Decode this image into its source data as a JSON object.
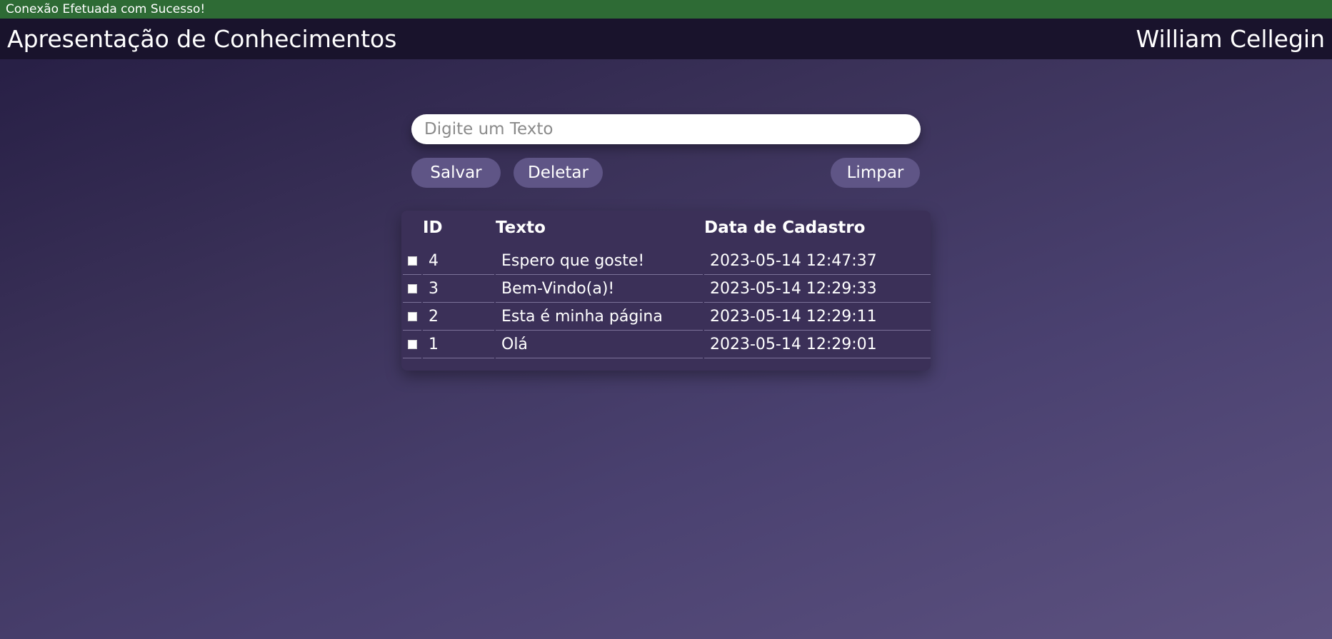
{
  "status": {
    "message": "Conexão Efetuada com Sucesso!",
    "color": "#2e6b35"
  },
  "header": {
    "title": "Apresentação de Conhecimentos",
    "author": "William Cellegin"
  },
  "form": {
    "input_value": "",
    "input_placeholder": "Digite um Texto",
    "save_label": "Salvar",
    "delete_label": "Deletar",
    "clear_label": "Limpar"
  },
  "table": {
    "columns": [
      "ID",
      "Texto",
      "Data de Cadastro"
    ],
    "rows": [
      {
        "checked": false,
        "id": "4",
        "text": "Espero que goste!",
        "date": "2023-05-14 12:47:37"
      },
      {
        "checked": false,
        "id": "3",
        "text": "Bem-Vindo(a)!",
        "date": "2023-05-14 12:29:33"
      },
      {
        "checked": false,
        "id": "2",
        "text": "Esta é minha página",
        "date": "2023-05-14 12:29:11"
      },
      {
        "checked": false,
        "id": "1",
        "text": "Olá",
        "date": "2023-05-14 12:29:01"
      }
    ]
  },
  "colors": {
    "header_bg": "#19132c",
    "button_bg": "#5f5586",
    "card_bg": "#3b3058"
  }
}
